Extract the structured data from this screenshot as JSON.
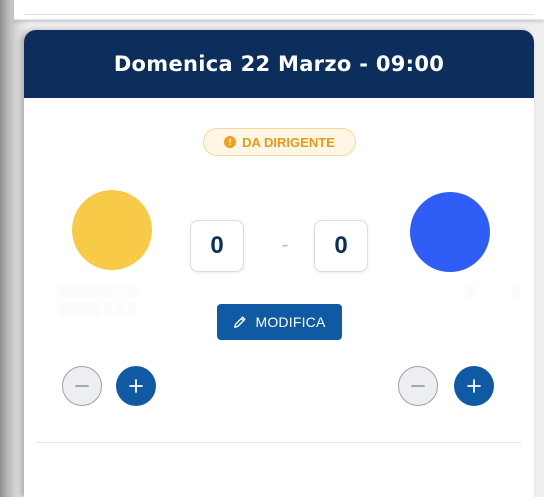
{
  "match": {
    "date_time": "Domenica 22 Marzo - 09:00",
    "badge_label": "DA DIRIGENTE",
    "badge_icon": "info-icon",
    "home": {
      "color": "#f7cb48",
      "score": "0"
    },
    "away": {
      "color": "#2e5ef5",
      "score": "0"
    },
    "separator": "-",
    "edit_label": "MODIFICA",
    "edit_icon": "pencil-icon"
  },
  "colors": {
    "header": "#0c2e5c",
    "accent": "#0f5aa3",
    "badge_text": "#e69a14"
  }
}
